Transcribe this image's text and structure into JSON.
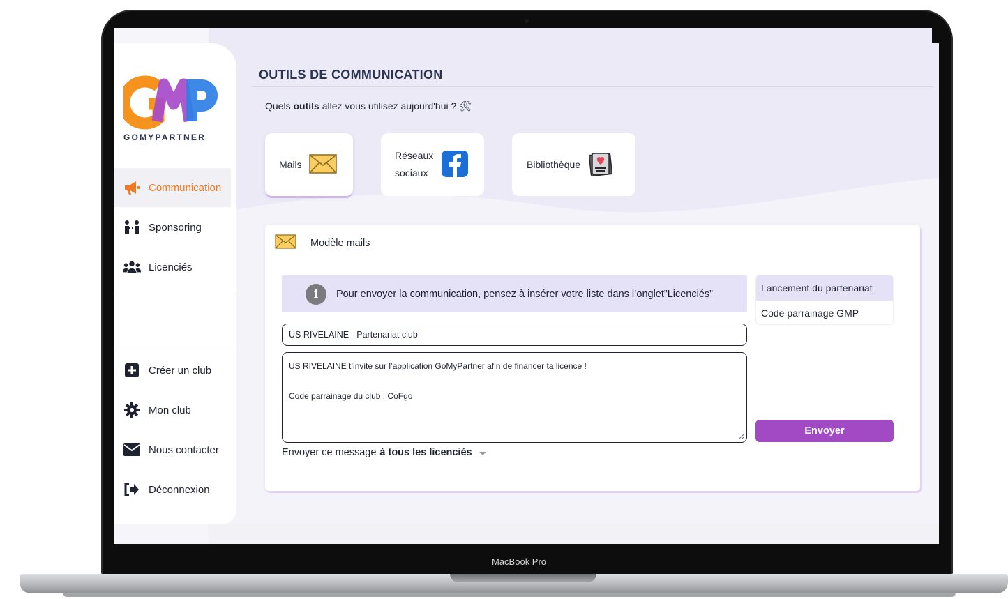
{
  "device": {
    "label": "MacBook Pro"
  },
  "brand": {
    "logo_letters": "GMP",
    "name": "GOMYPARTNER"
  },
  "colors": {
    "accent_orange": "#f07a23",
    "accent_purple": "#a249c4",
    "accent_blue": "#2f7fe4",
    "info_bg": "#e5e1f7",
    "title": "#2a3350"
  },
  "sidebar": {
    "primary": [
      {
        "label": "Communication",
        "icon": "megaphone-icon",
        "active": true
      },
      {
        "label": "Sponsoring",
        "icon": "handshake-people-icon"
      },
      {
        "label": "Licenciés",
        "icon": "users-group-icon"
      }
    ],
    "secondary": [
      {
        "label": "Créer un club",
        "icon": "plus-square-icon"
      },
      {
        "label": "Mon club",
        "icon": "gear-icon"
      },
      {
        "label": "Nous contacter",
        "icon": "envelope-icon"
      },
      {
        "label": "Déconnexion",
        "icon": "sign-out-icon"
      }
    ]
  },
  "page": {
    "title": "OUTILS DE COMMUNICATION",
    "subtitle_prefix": "Quels ",
    "subtitle_bold": "outils",
    "subtitle_suffix": " allez vous utilisez aujourd'hui ? 🛠"
  },
  "tools": [
    {
      "label": "Mails",
      "icon": "envelope-icon"
    },
    {
      "label_line1": "Réseaux",
      "label_line2": "sociaux",
      "icon": "facebook-icon"
    },
    {
      "label": "Bibliothèque",
      "icon": "framed-picture-icon"
    }
  ],
  "mail_panel": {
    "title": "Modèle mails",
    "info_text": "Pour envoyer la communication, pensez à insérer votre liste dans l’onglet”Licenciés”",
    "subject_value": "US RIVELAINE - Partenariat club",
    "body_line1": "US RIVELAINE t’invite sur l’application GoMyPartner afin de financer ta licence !",
    "body_line2": "Code parrainage du club : CoFgo",
    "audience_prefix": "Envoyer ce message",
    "audience_selected": "à tous les licenciés",
    "templates": [
      "Lancement du partenariat",
      "Code parrainage GMP"
    ],
    "send_label": "Envoyer"
  }
}
